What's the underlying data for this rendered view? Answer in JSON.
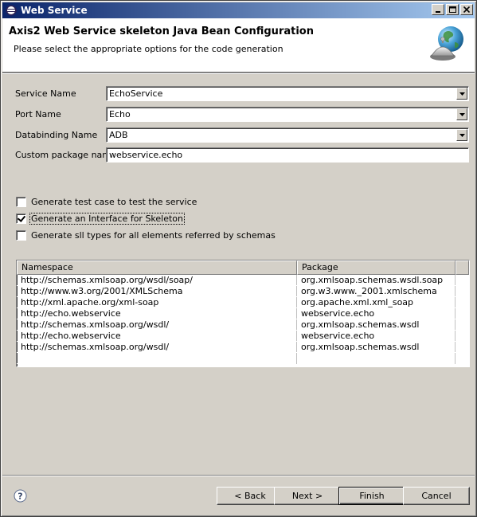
{
  "window": {
    "title": "Web Service",
    "controls": {
      "minimize": "_",
      "maximize": "□",
      "close": "×"
    }
  },
  "banner": {
    "title": "Axis2 Web Service skeleton Java Bean Configuration",
    "subtitle": "Please select the appropriate options for the code generation",
    "icon": "globe-service-bell-icon"
  },
  "form": {
    "service_name": {
      "label": "Service Name",
      "value": "EchoService"
    },
    "port_name": {
      "label": "Port Name",
      "value": "Echo"
    },
    "databinding_name": {
      "label": "Databinding Name",
      "value": "ADB"
    },
    "custom_package": {
      "label": "Custom package name",
      "value": "webservice.echo"
    }
  },
  "options": [
    {
      "label": "Generate test case to test the service",
      "checked": false
    },
    {
      "label": "Generate an Interface for Skeleton",
      "checked": true
    },
    {
      "label": "Generate sll types for all elements referred by schemas",
      "checked": false
    }
  ],
  "mapping_table": {
    "columns": [
      "Namespace",
      "Package"
    ],
    "rows": [
      [
        "http://schemas.xmlsoap.org/wsdl/soap/",
        "org.xmlsoap.schemas.wsdl.soap"
      ],
      [
        "http://www.w3.org/2001/XMLSchema",
        "org.w3.www._2001.xmlschema"
      ],
      [
        "http://xml.apache.org/xml-soap",
        "org.apache.xml.xml_soap"
      ],
      [
        "http://echo.webservice",
        "webservice.echo"
      ],
      [
        "http://schemas.xmlsoap.org/wsdl/",
        "org.xmlsoap.schemas.wsdl"
      ],
      [
        "http://echo.webservice",
        "webservice.echo"
      ],
      [
        "http://schemas.xmlsoap.org/wsdl/",
        "org.xmlsoap.schemas.wsdl"
      ]
    ]
  },
  "buttons": {
    "help_icon": "help-icon",
    "back": "< Back",
    "next": "Next >",
    "finish": "Finish",
    "cancel": "Cancel"
  }
}
